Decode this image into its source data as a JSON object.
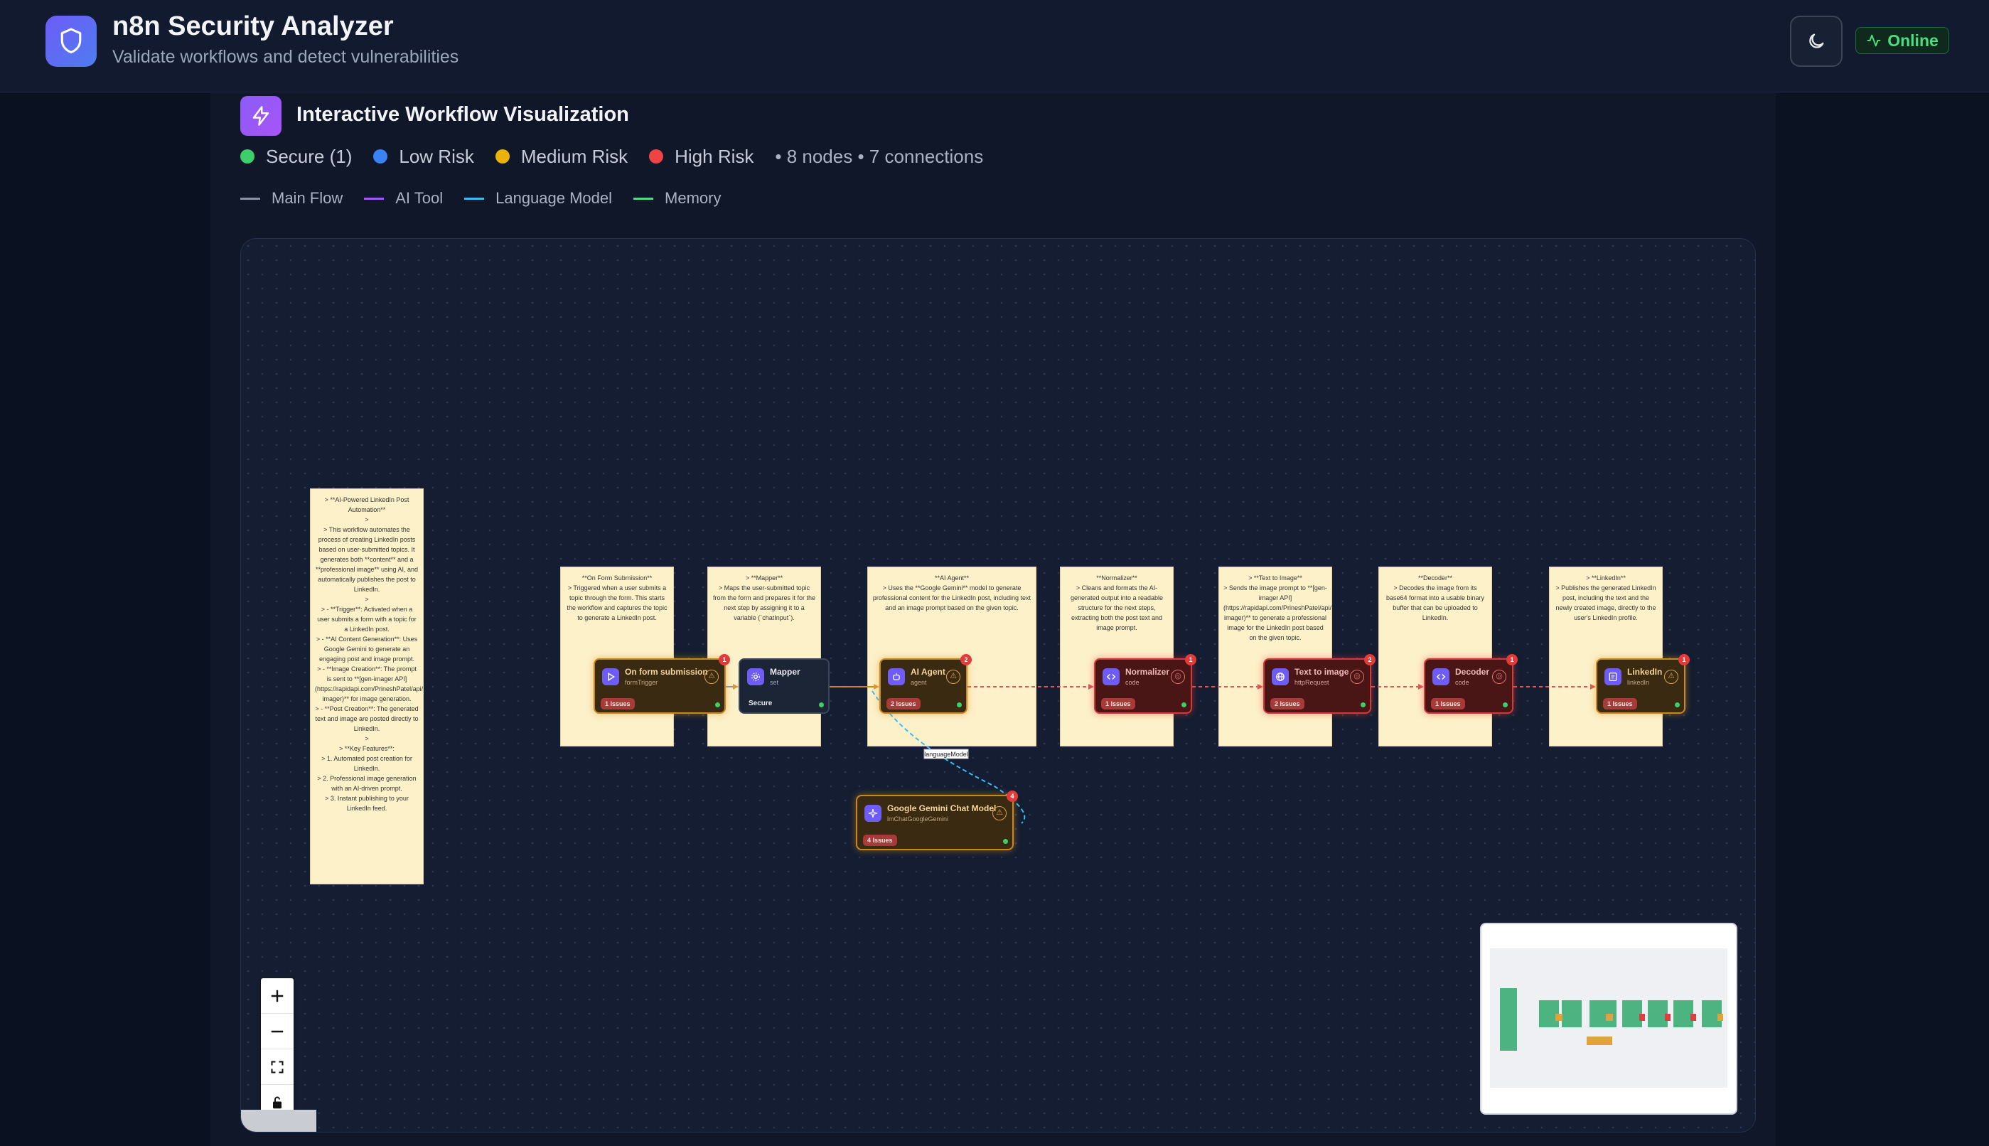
{
  "app": {
    "title": "n8n Security Analyzer",
    "subtitle": "Validate workflows and detect vulnerabilities",
    "status": "Online",
    "icon": "shield-icon",
    "theme_icon": "moon-icon"
  },
  "section": {
    "title": "Interactive Workflow Visualization",
    "icon": "lightning-icon"
  },
  "risk_legend": [
    {
      "label": "Secure (1)",
      "color": "#3ccf6a"
    },
    {
      "label": "Low Risk",
      "color": "#3b82f6"
    },
    {
      "label": "Medium Risk",
      "color": "#eab308"
    },
    {
      "label": "High Risk",
      "color": "#ef4444"
    }
  ],
  "stats": "• 8 nodes • 7 connections",
  "edge_legend": [
    {
      "label": "Main Flow",
      "color": "#8a93a6"
    },
    {
      "label": "AI Tool",
      "color": "#a855f7"
    },
    {
      "label": "Language Model",
      "color": "#38bdf8"
    },
    {
      "label": "Memory",
      "color": "#4ade80"
    }
  ],
  "notes": {
    "overview": "> **AI-Powered LinkedIn Post Automation**\n>\n> This workflow automates the process of creating LinkedIn posts based on user-submitted topics. It generates both **content** and a **professional image** using AI, and automatically publishes the post to LinkedIn.\n>\n> - **Trigger**: Activated when a user submits a form with a topic for a LinkedIn post.\n> - **AI Content Generation**: Uses Google Gemini to generate an engaging post and image prompt.\n> - **Image Creation**: The prompt is sent to **[gen-imager API](https://rapidapi.com/PrineshPatel/api/gen-imager)** for image generation.\n> - **Post Creation**: The generated text and image are posted directly to LinkedIn.\n>\n> **Key Features**:\n> 1. Automated post creation for LinkedIn.\n> 2. Professional image generation with an AI-driven prompt.\n> 3. Instant publishing to your LinkedIn feed.",
    "form": "**On Form Submission**\n> Triggered when a user submits a topic through the form. This starts the workflow and captures the topic to generate a LinkedIn post.",
    "mapper": "> **Mapper**\n> Maps the user-submitted topic from the form and prepares it for the next step by assigning it to a variable (`chatInput`).",
    "agent": "**AI Agent**\n> Uses the **Google Gemini** model to generate professional content for the LinkedIn post, including text and an image prompt based on the given topic.",
    "normalizer": "**Normalizer**\n> Cleans and formats the AI-generated output into a readable structure for the next steps, extracting both the post text and image prompt.",
    "text_to_image": "> **Text to Image**\n> Sends the image prompt to **[gen-imager API](https://rapidapi.com/PrineshPatel/api/gen-imager)** to generate a professional image for the LinkedIn post based on the given topic.",
    "decoder": "**Decoder**\n> Decodes the image from its base64 format into a usable binary buffer that can be uploaded to LinkedIn.",
    "linkedin": "> **LinkedIn**\n> Publishes the generated LinkedIn post, including the text and the newly created image, directly to the user's LinkedIn profile."
  },
  "nodes": {
    "form": {
      "name": "On form submission",
      "type": "formTrigger",
      "badge": "1 Issues",
      "count": "1",
      "risk": "medium",
      "icon": "play-icon"
    },
    "mapper": {
      "name": "Mapper",
      "type": "set",
      "status": "Secure",
      "risk": "secure",
      "icon": "settings-icon"
    },
    "agent": {
      "name": "AI Agent",
      "type": "agent",
      "badge": "2 Issues",
      "count": "2",
      "risk": "medium",
      "icon": "robot-icon"
    },
    "normalizer": {
      "name": "Normalizer",
      "type": "code",
      "badge": "1 Issues",
      "count": "1",
      "risk": "high",
      "icon": "code-icon"
    },
    "text_to_image": {
      "name": "Text to image",
      "type": "httpRequest",
      "badge": "2 Issues",
      "count": "2",
      "risk": "high",
      "icon": "globe-icon"
    },
    "decoder": {
      "name": "Decoder",
      "type": "code",
      "badge": "1 Issues",
      "count": "1",
      "risk": "high",
      "icon": "code-icon"
    },
    "linkedin": {
      "name": "LinkedIn",
      "type": "linkedIn",
      "badge": "1 Issues",
      "count": "1",
      "risk": "medium",
      "icon": "linkedin-icon"
    },
    "gemini": {
      "name": "Google Gemini Chat Model",
      "type": "lmChatGoogleGemini",
      "badge": "4 Issues",
      "count": "4",
      "risk": "medium",
      "icon": "sparkle-icon"
    }
  },
  "edge_label": "languageModel",
  "controls": {
    "zoom_in": "+",
    "zoom_out": "−",
    "fit": "fit-view-icon",
    "lock": "lock-icon"
  }
}
